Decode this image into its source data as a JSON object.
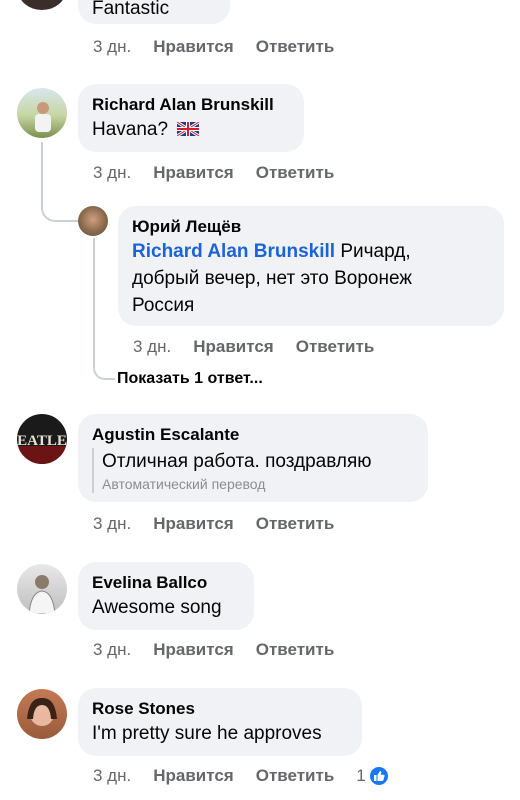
{
  "colors": {
    "bubble": "#f0f2f5",
    "meta": "#65676b",
    "mention": "#1b64d8",
    "like_blue": "#1877f2",
    "thread_line": "#ccd0d5"
  },
  "actions": {
    "like": "Нравится",
    "reply": "Ответить"
  },
  "comments": [
    {
      "text": "Fantastic",
      "time": "3 дн."
    },
    {
      "name": "Richard Alan Brunskill",
      "text": "Havana?",
      "flag_icon": "uk-flag-icon",
      "time": "3 дн."
    },
    {
      "name": "Юрий Лещёв",
      "mention": "Richard Alan Brunskill",
      "text_lines": [
        "Ричард,",
        "добрый вечер, нет это Воронеж",
        "Россия"
      ],
      "time": "3 дн."
    },
    {
      "name": "Agustin Escalante",
      "text": "Отличная работа. поздравляю",
      "translation_note": "Автоматический перевод",
      "avatar_text": "EATLE",
      "time": "3 дн."
    },
    {
      "name": "Evelina Ballco",
      "text": "Awesome song",
      "time": "3 дн."
    },
    {
      "name": "Rose Stones",
      "text": "I'm pretty sure he approves",
      "time": "3 дн.",
      "like_count": "1"
    }
  ],
  "view_replies": "Показать 1 ответ..."
}
